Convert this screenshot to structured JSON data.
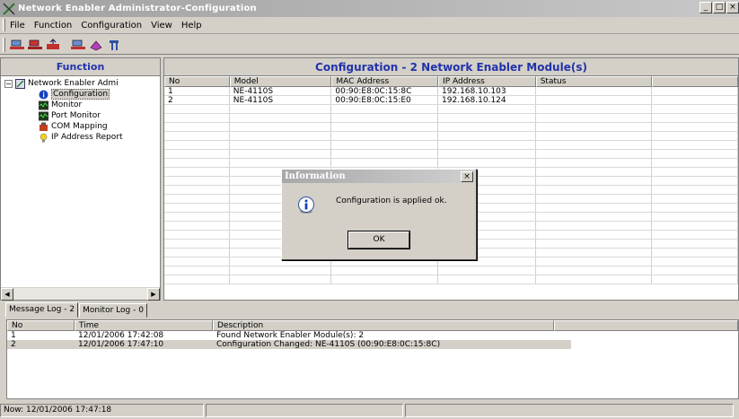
{
  "window": {
    "title": "Network Enabler Administrator-Configuration",
    "controls": [
      "_",
      "□",
      "×"
    ]
  },
  "menu": [
    "File",
    "Function",
    "Configuration",
    "View",
    "Help"
  ],
  "toolbar": {
    "icons": [
      "search-network-icon",
      "stop-search-icon",
      "apply-config-icon",
      "export-config-icon",
      "import-config-icon",
      "properties-icon"
    ]
  },
  "function_pane": {
    "header": "Function",
    "root_label": "Network Enabler Admi",
    "items": [
      {
        "label": "Configuration",
        "icon": "info-icon"
      },
      {
        "label": "Monitor",
        "icon": "monitor-icon"
      },
      {
        "label": "Port Monitor",
        "icon": "port-monitor-icon"
      },
      {
        "label": "COM Mapping",
        "icon": "com-mapping-icon"
      },
      {
        "label": "IP Address Report",
        "icon": "ip-report-icon"
      }
    ]
  },
  "config_pane": {
    "header": "Configuration - 2 Network Enabler Module(s)",
    "columns": [
      "No",
      "Model",
      "MAC Address",
      "IP Address",
      "Status"
    ],
    "rows": [
      {
        "no": "1",
        "model": "NE-4110S",
        "mac": "00:90:E8:0C:15:8C",
        "ip": "192.168.10.103",
        "status": ""
      },
      {
        "no": "2",
        "model": "NE-4110S",
        "mac": "00:90:E8:0C:15:E0",
        "ip": "192.168.10.124",
        "status": ""
      }
    ]
  },
  "dialog": {
    "title": "Information",
    "message": "Configuration is applied ok.",
    "ok_label": "OK",
    "close_label": "×"
  },
  "log_tabs": [
    "Message Log - 2",
    "Monitor Log - 0"
  ],
  "log": {
    "columns": [
      "No",
      "Time",
      "Description"
    ],
    "rows": [
      {
        "no": "1",
        "time": "12/01/2006 17:42:08",
        "desc": "Found Network Enabler Module(s): 2"
      },
      {
        "no": "2",
        "time": "12/01/2006 17:47:10",
        "desc": "Configuration Changed: NE-4110S (00:90:E8:0C:15:8C)"
      }
    ]
  },
  "status": {
    "now": "Now: 12/01/2006 17:47:18"
  },
  "colors": {
    "accent_header": "#2233aa",
    "face": "#d4d0c8"
  }
}
